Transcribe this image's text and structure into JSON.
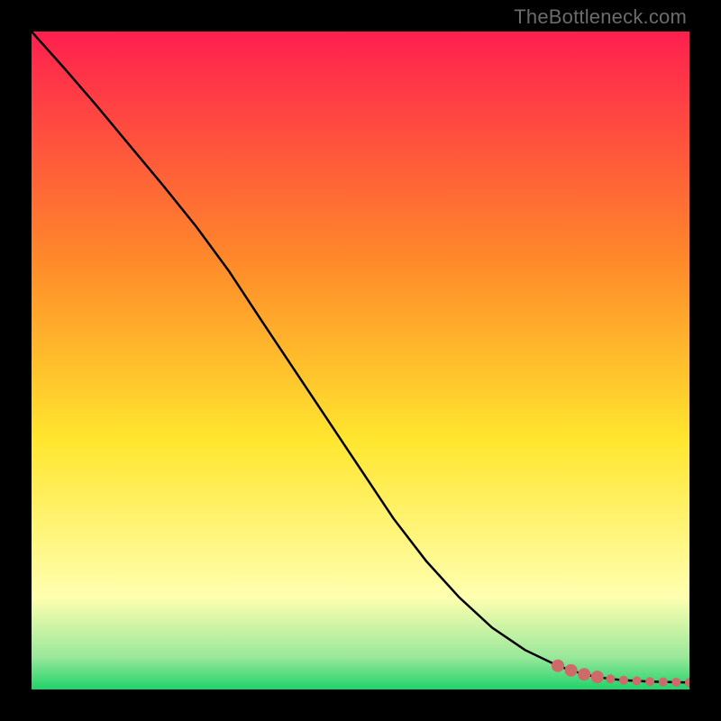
{
  "watermark": "TheBottleneck.com",
  "colors": {
    "bg_black": "#000000",
    "curve_stroke": "#000000",
    "marker_fill": "#cf6a6a",
    "marker_stroke": "#cf6a6a",
    "grad_top": "#ff1f4f",
    "grad_mid_upper": "#ff8a2a",
    "grad_mid": "#ffe62e",
    "grad_pale": "#ffffb0",
    "grad_green_light": "#9be89b",
    "grad_green": "#1fd36a"
  },
  "chart_data": {
    "type": "line",
    "title": "",
    "xlabel": "",
    "ylabel": "",
    "xlim": [
      0,
      100
    ],
    "ylim": [
      0,
      100
    ],
    "grid": false,
    "legend": false,
    "series": [
      {
        "name": "bottleneck-curve",
        "x": [
          0,
          5,
          10,
          15,
          20,
          25,
          30,
          35,
          40,
          45,
          50,
          55,
          60,
          65,
          70,
          75,
          80,
          82,
          84,
          86,
          88,
          90,
          92,
          94,
          96,
          98,
          100
        ],
        "y": [
          100,
          94.4,
          88.6,
          82.6,
          76.6,
          70.4,
          63.6,
          56.0,
          48.5,
          41.0,
          33.5,
          26.0,
          19.5,
          14.0,
          9.4,
          6.0,
          3.6,
          2.9,
          2.3,
          1.9,
          1.6,
          1.4,
          1.3,
          1.2,
          1.15,
          1.1,
          1.05
        ]
      }
    ],
    "markers": {
      "name": "highlight-segment",
      "x": [
        80,
        82,
        84,
        86,
        88,
        90,
        92,
        94,
        96,
        98,
        100
      ],
      "y": [
        3.6,
        2.9,
        2.3,
        1.9,
        1.6,
        1.4,
        1.3,
        1.2,
        1.15,
        1.1,
        1.05
      ]
    }
  }
}
